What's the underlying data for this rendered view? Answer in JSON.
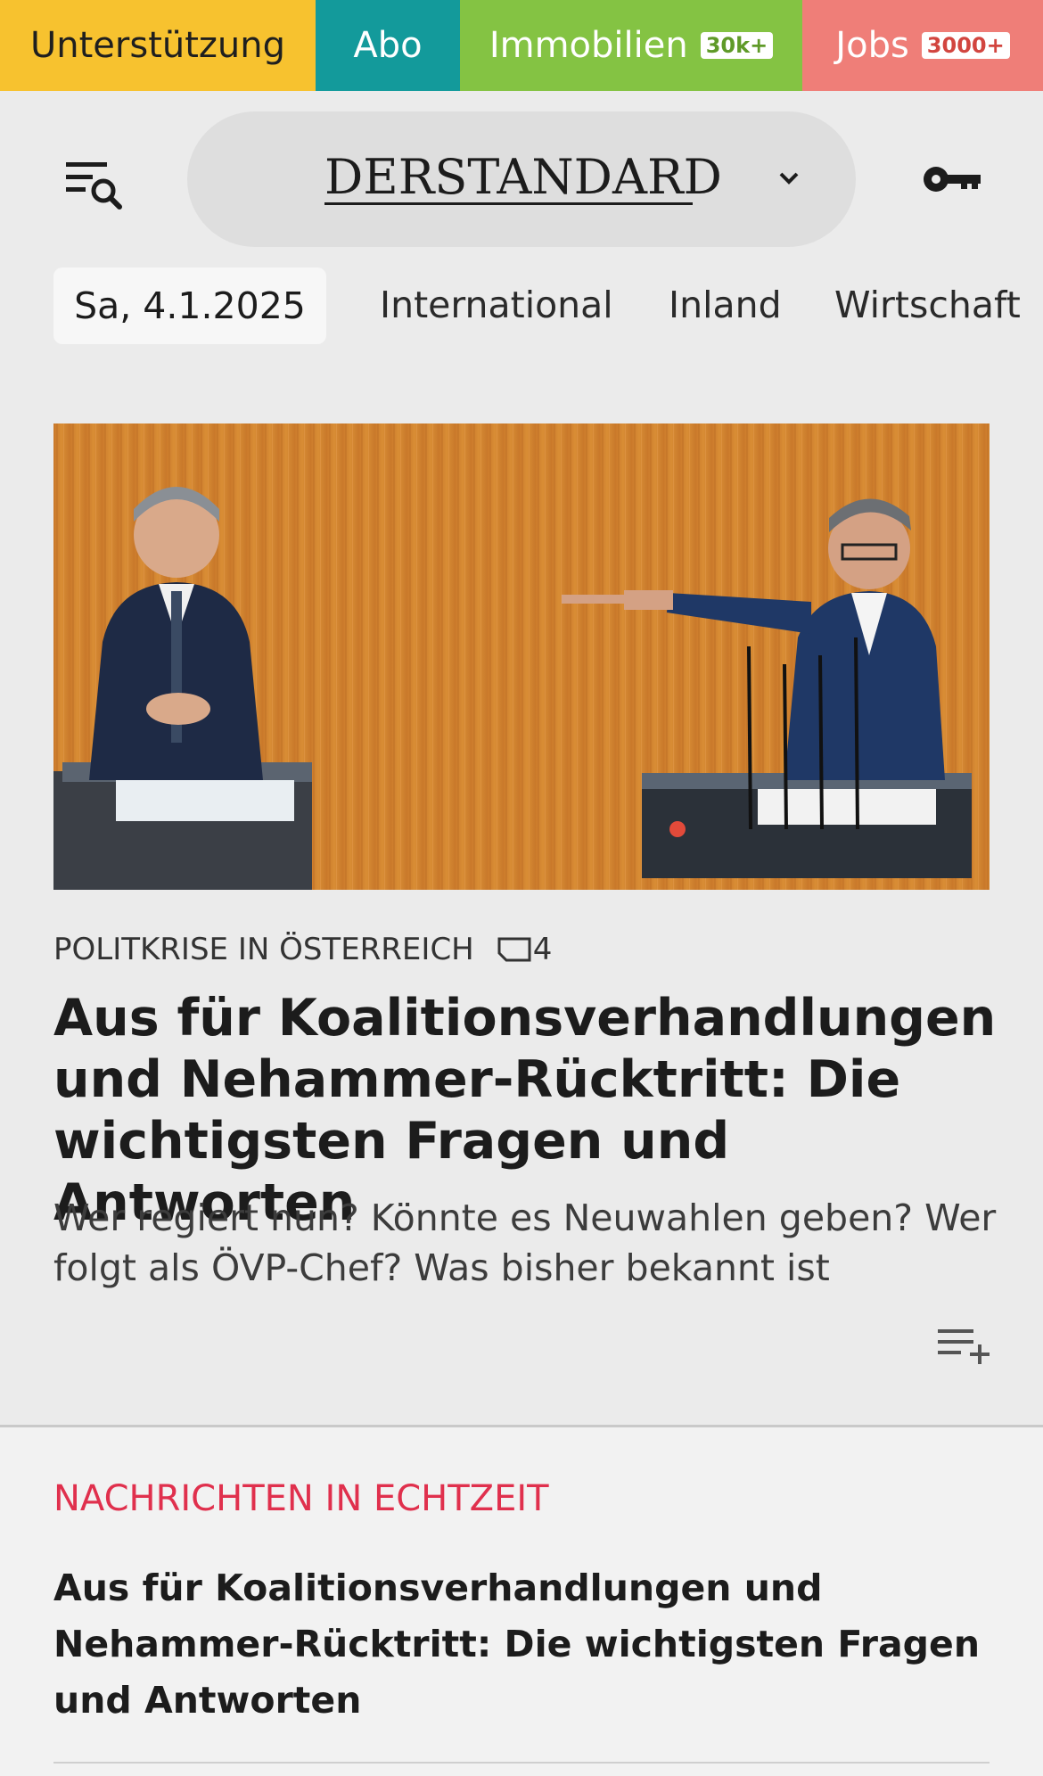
{
  "topbar": {
    "support_label": "Unterstützung",
    "abo_label": "Abo",
    "immo_label": "Immobilien",
    "immo_badge": "30k+",
    "jobs_label": "Jobs",
    "jobs_badge": "3000+"
  },
  "header": {
    "logo_text": "DERSTANDARD",
    "menu_icon": "menu-search-icon",
    "dropdown_icon": "chevron-down-icon",
    "login_icon": "key-icon"
  },
  "nav": {
    "date": "Sa, 4.1.2025",
    "items": [
      "International",
      "Inland",
      "Wirtschaft"
    ]
  },
  "hero": {
    "kicker": "POLITKRISE IN ÖSTERREICH",
    "posting_count": "4",
    "headline": "Aus für Koalitionsverhandlungen und Nehammer-Rücktritt: Die wichtigsten Fragen und Antworten",
    "lead": "Wer regiert nun? Könnte es Neuwahlen geben? Wer folgt als ÖVP-Chef? Was bisher bekannt ist",
    "add_icon": "add-to-list-icon"
  },
  "live": {
    "label": "NACHRICHTEN IN ECHTZEIT",
    "title": "Aus für Koalitionsverhandlungen und Nehammer-Rücktritt: Die wichtigsten Fragen und Antworten"
  },
  "colors": {
    "support": "#f7c22f",
    "abo": "#139a9b",
    "immobilien": "#84c343",
    "jobs": "#ef7e78",
    "live_accent": "#e0304d"
  }
}
